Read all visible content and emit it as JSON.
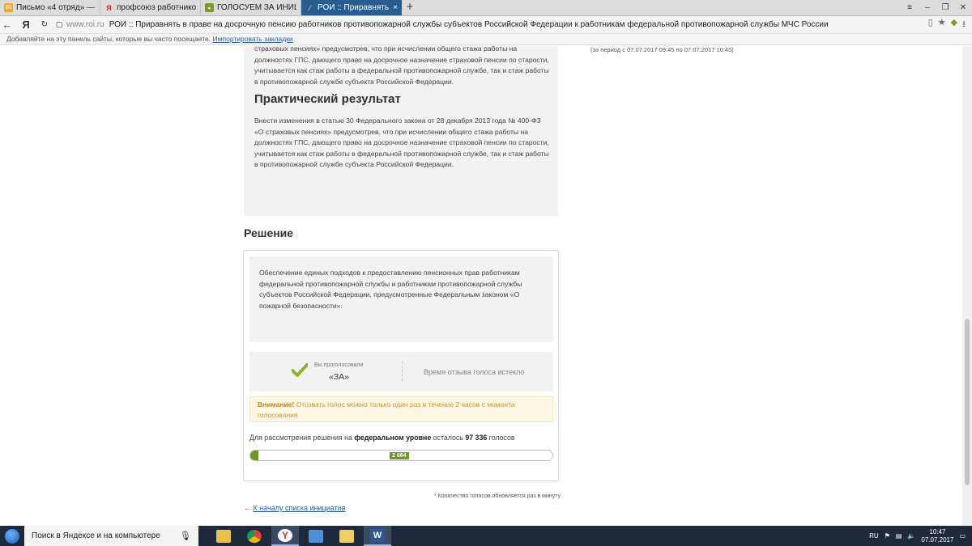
{
  "browser": {
    "tabs": [
      {
        "title": "Письмо «4 отряд» — Дим",
        "icon": "mail-icon",
        "color": "#f5a623",
        "active": false
      },
      {
        "title": "профсоюз работников гос",
        "icon": "yandex-icon",
        "color": "#d52b1e",
        "active": false
      },
      {
        "title": "ГОЛОСУЕМ ЗА ИНИЦИАТИ",
        "icon": "flag-icon",
        "color": "#7a9a2a",
        "active": false
      },
      {
        "title": "РОИ :: Приравнять в пра",
        "icon": "roi-icon",
        "color": "#9ec3ea",
        "active": true
      }
    ],
    "new_tab": "+",
    "address": {
      "yandex_label": "Я",
      "host": "www.roi.ru",
      "title": "РОИ :: Приравнять в праве на досрочную пенсию работников противопожарной службы субъектов Российской Федерации к работникам федеральной противопожарной службы МЧС России"
    },
    "bookmarks_bar": {
      "text": "Добавляйте на эту панель сайты, которые вы часто посещаете.",
      "link": "Импортировать закладки"
    }
  },
  "page": {
    "intro_paragraph": "страховых пенсиях» предусмотрев, что при исчислении общего стажа работы на должностях ГПС, дающего право на досрочное назначение страховой пенсии по старости, учитывается как стаж работы в федеральной противопожарной службе, так и стаж работы в противопожарной службе субъекта Российской Федерации.",
    "practical_title": "Практический результат",
    "practical_paragraph": "Внести изменения в статью 30 Федерального закона от 28 декабря 2013 года № 400-ФЗ «О страховых пенсиях» предусмотрев, что при исчислении общего стажа работы на должностях ГПС, дающего право на досрочное назначение страховой пенсии по старости, учитывается как стаж работы в федеральной противопожарной службе, так и стаж работы в противопожарной службе субъекта Российской Федерации.",
    "side_period": "(за период с 07.07.2017 09:45 по 07.07.2017 10:45)",
    "decision_title": "Решение",
    "decision_text": "Обеспечение единых подходов к предоставлению пенсионных прав работникам федеральной противопожарной службы и работникам противопожарной службы субъектов Российской Федерации, предусмотренные Федеральным законом «О пожарной безопасности».",
    "vote": {
      "label": "Вы проголосовали",
      "value": "«ЗА»",
      "expired": "Время отзыва голоса истекло",
      "accent_color": "#8bb52a"
    },
    "warning": {
      "strong": "Внимание!",
      "text": " Отозвать голос можно только один раз в течение 2 часов с момента голосования"
    },
    "remaining": {
      "prefix": "Для рассмотрения решения на ",
      "level": "федеральном уровне",
      "middle": " осталось ",
      "count": "97 336",
      "suffix": " голосов"
    },
    "progress": {
      "votes_label": "2 664",
      "votes": 2664,
      "total": 100000,
      "color": "#6a9a20"
    },
    "footnote": "* Количество голосов обновляется раз в минуту",
    "back_arrow": "←",
    "back_link": "К началу списка инициатив"
  },
  "taskbar": {
    "search_placeholder": "Поиск в Яндексе и на компьютере",
    "apps": [
      "file-explorer-icon",
      "chrome-icon",
      "yandex-browser-icon",
      "remote-desktop-icon",
      "folder-icon",
      "word-icon"
    ],
    "language": "RU",
    "time": "10:47",
    "date": "07.07.2017"
  }
}
